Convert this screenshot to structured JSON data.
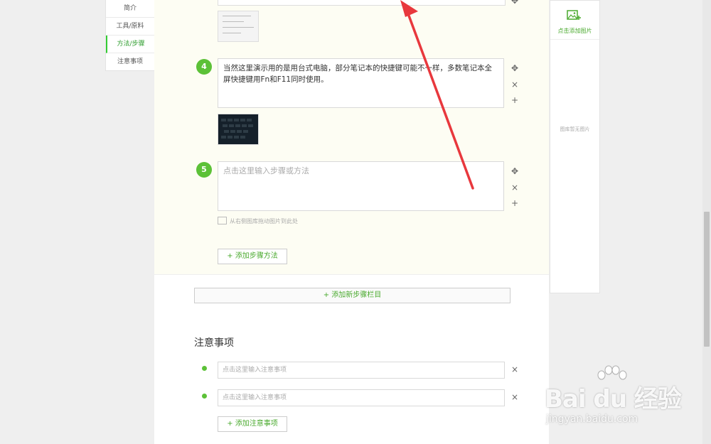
{
  "nav": {
    "items": [
      {
        "label": "简介"
      },
      {
        "label": "工具/原料"
      },
      {
        "label": "方法/步骤"
      },
      {
        "label": "注意事项"
      }
    ]
  },
  "steps": [
    {
      "number": "4",
      "text": "当然这里演示用的是用台式电脑，部分笔记本的快捷键可能不一样，多数笔记本全屏快捷键用Fn和F11同时使用。"
    },
    {
      "number": "5",
      "placeholder": "点击这里输入步骤或方法"
    }
  ],
  "drag_hint": "从右侧图库拖动图片到此处",
  "add_step_label": "+ 添加步骤方法",
  "add_section_label": "+ 添加新步骤栏目",
  "notes": {
    "title": "注意事项",
    "placeholder": "点击这里输入注意事项",
    "add_label": "+ 添加注意事项"
  },
  "image_panel": {
    "add_label": "点击添加图片",
    "empty_text": "图库暂无图片"
  },
  "controls": {
    "move_glyph": "✥",
    "close_glyph": "×",
    "add_glyph": "+"
  },
  "watermark": {
    "brand": "Bai du 经验",
    "url": "jingyan.baidu.com"
  },
  "colors": {
    "accent": "#5cc137",
    "link": "#4aaa2e",
    "arrow": "#e8383d"
  }
}
